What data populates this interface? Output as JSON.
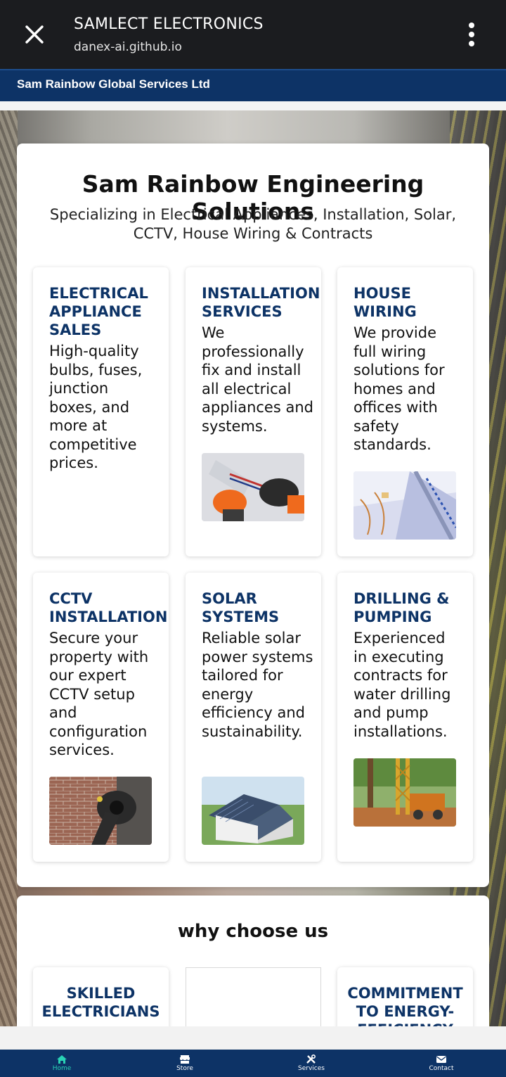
{
  "browser": {
    "title": "SAMLECT ELECTRONICS",
    "url": "danex-ai.github.io",
    "close_icon": "close-icon",
    "menu_icon": "more-vert-icon"
  },
  "header": {
    "brand": "Sam Rainbow Global Services Ltd"
  },
  "hero": {
    "title": "Sam Rainbow Engineering Solutions",
    "tagline": "Specializing in Electrical Appliances, Installation, Solar, CCTV, House Wiring & Contracts"
  },
  "services": [
    {
      "title": "ELECTRICAL APPLIANCE SALES",
      "desc": "High-quality bulbs, fuses, junction boxes, and more at competitive prices."
    },
    {
      "title": "INSTALLATION SERVICES",
      "desc": "We professionally fix and install all electrical appliances and systems."
    },
    {
      "title": "HOUSE WIRING",
      "desc": "We provide full wiring solutions for homes and offices with safety standards."
    },
    {
      "title": "CCTV INSTALLATION",
      "desc": "Secure your property with our expert CCTV setup and configuration services."
    },
    {
      "title": "SOLAR SYSTEMS",
      "desc": "Reliable solar power systems tailored for energy efficiency and sustainability."
    },
    {
      "title": "DRILLING & PUMPING",
      "desc": "Experienced in executing contracts for water drilling and pump installations."
    }
  ],
  "why": {
    "title": "why choose us",
    "items": [
      {
        "title": "SKILLED ELECTRICIANS"
      },
      {
        "title": ""
      },
      {
        "title": "COMMITMENT TO ENERGY-EFFICIENCY"
      }
    ]
  },
  "nav": {
    "items": [
      {
        "label": "Home",
        "icon": "home-icon",
        "active": true
      },
      {
        "label": "Store",
        "icon": "store-icon",
        "active": false
      },
      {
        "label": "Services",
        "icon": "tools-icon",
        "active": false
      },
      {
        "label": "Contact",
        "icon": "envelope-icon",
        "active": false
      }
    ],
    "active_color": "#29d3b5",
    "bar_color": "#0d3366"
  }
}
